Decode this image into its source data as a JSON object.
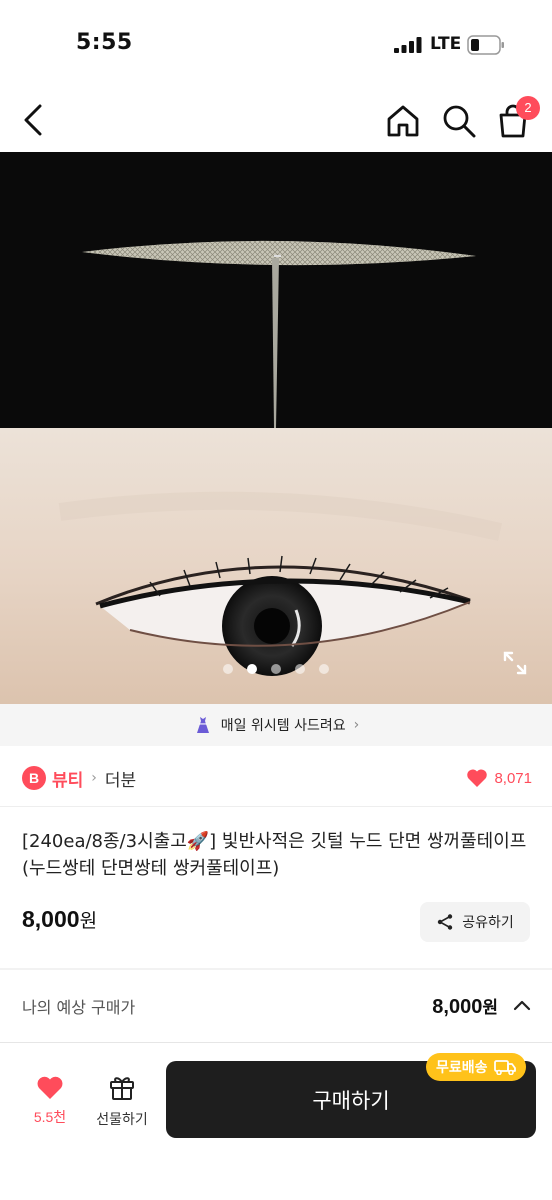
{
  "status_bar": {
    "time": "5:55",
    "network": "LTE"
  },
  "nav": {
    "cart_badge": "2",
    "icons": [
      "back-icon",
      "home-icon",
      "search-icon",
      "cart-icon"
    ]
  },
  "carousel": {
    "total_slides": 5,
    "active_index": 1
  },
  "banner": {
    "text": "매일 위시템 사드려요",
    "chevron": "›"
  },
  "category": {
    "badge": "B",
    "name": "뷰티",
    "separator": "›",
    "brand": "더분",
    "likes": "8,071"
  },
  "product": {
    "title": "[240ea/8종/3시출고🚀]  빛반사적은 깃털 누드 단면 쌍꺼풀테이프 (누드쌍테 단면쌍테 쌍커풀테이프)",
    "price": "8,000",
    "currency": "원",
    "share_label": "공유하기"
  },
  "expected_price": {
    "label": "나의 예상 구매가",
    "value": "8,000",
    "currency": "원"
  },
  "bottom_bar": {
    "like_count": "5.5천",
    "gift_label": "선물하기",
    "buy_label": "구매하기",
    "free_shipping_label": "무료배송"
  },
  "colors": {
    "accent": "#ff4c5b",
    "buy_button": "#1e1e1e",
    "shipping_badge": "#ffc21a"
  }
}
